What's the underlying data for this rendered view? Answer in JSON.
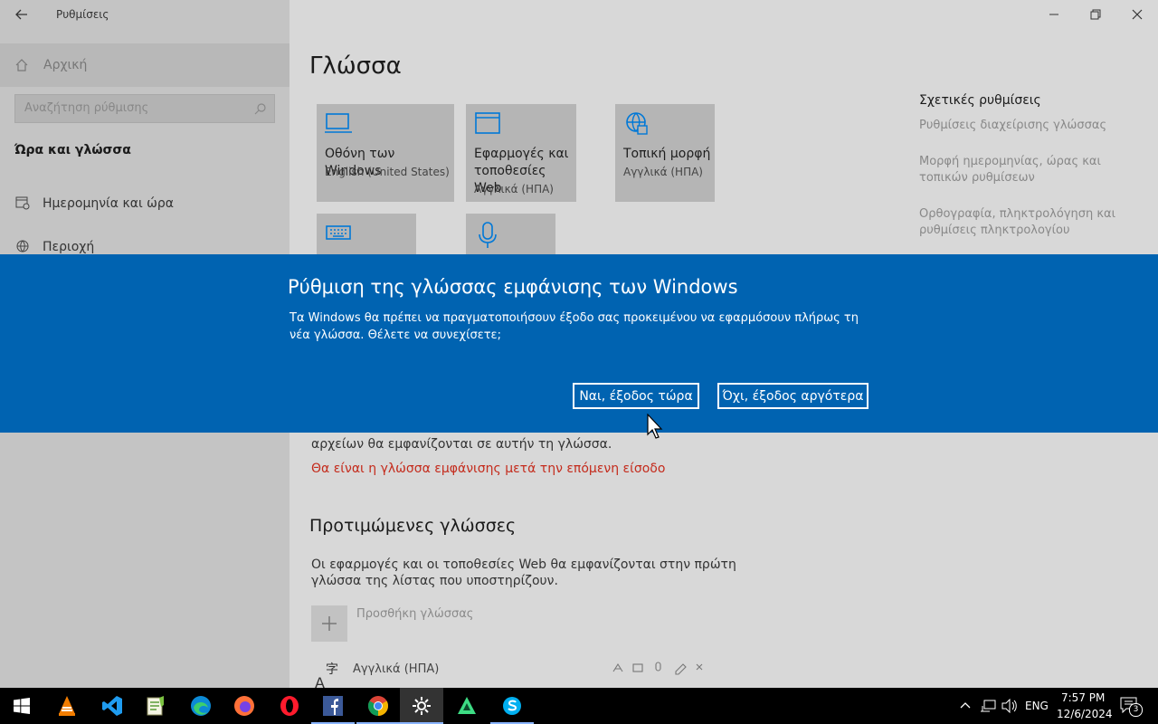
{
  "window": {
    "title": "Ρυθμίσεις",
    "back_icon": "back-arrow-icon",
    "minimize_icon": "minimize-icon",
    "restore_icon": "restore-icon",
    "close_icon": "close-icon"
  },
  "sidebar": {
    "home_label": "Αρχική",
    "search_placeholder": "Αναζήτηση ρύθμισης",
    "section_title": "Ώρα και γλώσσα",
    "items": [
      {
        "label": "Ημερομηνία και ώρα",
        "icon": "calendar-clock-icon"
      },
      {
        "label": "Περιοχή",
        "icon": "globe-region-icon"
      }
    ]
  },
  "main": {
    "page_title": "Γλώσσα",
    "tiles": [
      {
        "title": "Οθόνη των Windows",
        "subtitle": "English (United States)",
        "icon": "monitor-icon"
      },
      {
        "title": "Εφαρμογές και τοποθεσίες Web",
        "subtitle": "Αγγλικά (ΗΠΑ)",
        "icon": "window-icon"
      },
      {
        "title": "Τοπική μορφή",
        "subtitle": "Αγγλικά (ΗΠΑ)",
        "icon": "regional-format-icon"
      },
      {
        "title": "",
        "subtitle": "",
        "icon": "keyboard-icon"
      },
      {
        "title": "",
        "subtitle": "",
        "icon": "microphone-icon"
      }
    ],
    "partial_line_1": "αρχείων θα εμφανίζονται σε αυτήν τη γλώσσα.",
    "warning": "Θα είναι η γλώσσα εμφάνισης μετά την επόμενη είσοδο",
    "preferred_heading": "Προτιμώμενες γλώσσες",
    "preferred_desc_1": "Οι εφαρμογές και οι τοποθεσίες Web θα εμφανίζονται στην πρώτη",
    "preferred_desc_2": "γλώσσα της λίστας που υποστηρίζουν.",
    "add_language_label": "Προσθήκη γλώσσας",
    "language_entry": "Αγγλικά (ΗΠΑ)"
  },
  "related": {
    "heading": "Σχετικές ρυθμίσεις",
    "links": [
      {
        "line1": "Ρυθμίσεις διαχείρισης γλώσσας",
        "line2": ""
      },
      {
        "line1": "Μορφή ημερομηνίας, ώρας και",
        "line2": "τοπικών ρυθμίσεων"
      },
      {
        "line1": "Ορθογραφία, πληκτρολόγηση και",
        "line2": "ρυθμίσεις πληκτρολογίου"
      }
    ]
  },
  "dialog": {
    "title": "Ρύθμιση της γλώσσας εμφάνισης των Windows",
    "body_line1": "Τα Windows θα πρέπει να πραγματοποιήσουν έξοδο σας προκειμένου να εφαρμόσουν πλήρως τη",
    "body_line2": "νέα γλώσσα. Θέλετε να συνεχίσετε;",
    "yes_button": "Ναι, έξοδος τώρα",
    "no_button": "Όχι, έξοδος αργότερα"
  },
  "taskbar": {
    "apps": [
      "windows-start-icon",
      "vlc-icon",
      "vscode-icon",
      "notepadpp-icon",
      "edge-icon",
      "firefox-icon",
      "opera-icon",
      "facebook-icon",
      "chrome-icon",
      "settings-icon",
      "android-studio-icon",
      "skype-icon"
    ],
    "language": "ENG",
    "time": "7:57 PM",
    "date": "12/6/2024",
    "notification_count": "3"
  },
  "colors": {
    "dialog_blue": "#0063b1",
    "accent": "#0078d7",
    "warning_red": "#c42b1c"
  }
}
